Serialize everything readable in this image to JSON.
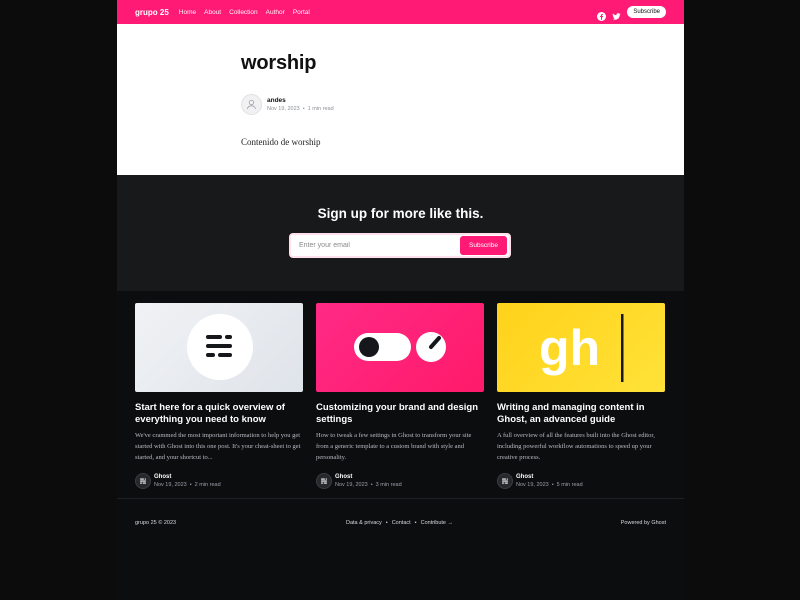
{
  "header": {
    "brand": "grupo 25",
    "nav": [
      "Home",
      "About",
      "Collection",
      "Author",
      "Portal"
    ],
    "subscribe_label": "Subscribe",
    "icons": [
      "facebook-icon",
      "twitter-icon"
    ],
    "accent": "#ff1a75"
  },
  "article": {
    "title": "worship",
    "author": "andes",
    "date": "Nov 19, 2023",
    "read_time": "1 min read",
    "content": "Contenido de worship"
  },
  "signup": {
    "title": "Sign up for more like this.",
    "email_placeholder": "Enter your email",
    "button_label": "Subscribe"
  },
  "cards": [
    {
      "title": "Start here for a quick overview of everything you need to know",
      "excerpt": "We've crammed the most important information to help you get started with Ghost into this one post. It's your cheat-sheet to get started, and your shortcut to...",
      "author": "Ghost",
      "date": "Nov 19, 2023",
      "read_time": "2 min read"
    },
    {
      "title": "Customizing your brand and design settings",
      "excerpt": "How to tweak a few settings in Ghost to transform your site from a generic template to a custom brand with style and personality.",
      "author": "Ghost",
      "date": "Nov 19, 2023",
      "read_time": "3 min read"
    },
    {
      "title": "Writing and managing content in Ghost, an advanced guide",
      "excerpt": "A full overview of all the features built into the Ghost editor, including powerful workflow automations to speed up your creative process.",
      "author": "Ghost",
      "date": "Nov 19, 2023",
      "read_time": "5 min read",
      "thumb_text": "gh"
    }
  ],
  "footer": {
    "copyright": "grupo 25 © 2023",
    "links": [
      "Data & privacy",
      "Contact",
      "Contribute →"
    ],
    "powered": "Powered by Ghost"
  }
}
